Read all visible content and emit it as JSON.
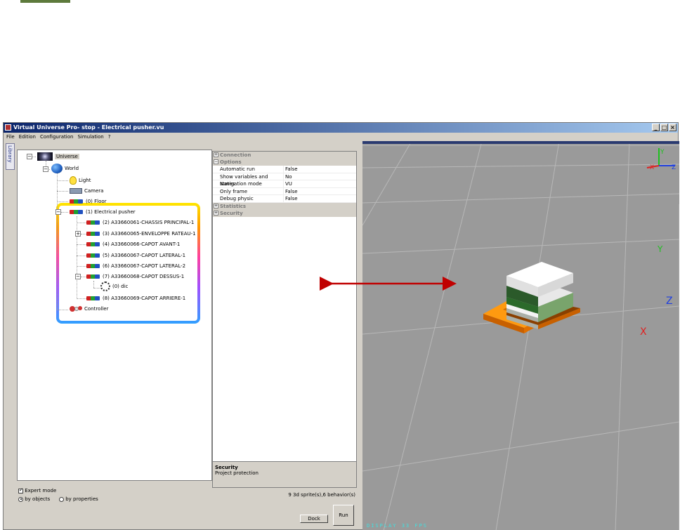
{
  "window": {
    "title": "Virtual Universe Pro- stop - Electrical pusher.vu",
    "buttons": [
      "_",
      "□",
      "×"
    ]
  },
  "menu": [
    "File",
    "Edition",
    "Configuration",
    "Simulation",
    "?"
  ],
  "library_tab": "Library",
  "tree": {
    "universe": "Universe",
    "world": "World",
    "light": "Light",
    "camera": "Camera",
    "floor": "(0) Floor",
    "pusher": "(1) Electrical pusher",
    "children": [
      "(2) A33660061-CHASSIS PRINCIPAL-1",
      "(3) A33660065-ENVELOPPE RATEAU-1",
      "(4) A33660066-CAPOT AVANT-1",
      "(5) A33660067-CAPOT LATERAL-1",
      "(6) A33660067-CAPOT LATERAL-2",
      "(7) A33660068-CAPOT DESSUS-1"
    ],
    "dic": "(0) dic",
    "last_child": "(8) A33660069-CAPOT ARRIERE-1",
    "controller": "Controller"
  },
  "properties": {
    "sections": {
      "connection": "Connection",
      "options": "Options",
      "statistics": "Statistics",
      "security": "Security"
    },
    "rows": [
      {
        "key": "Automatic run",
        "value": "False"
      },
      {
        "key": "Show variables and states",
        "value": "No"
      },
      {
        "key": "Navigation mode",
        "value": "VU"
      },
      {
        "key": "Only frame",
        "value": "False"
      },
      {
        "key": "Debug physic",
        "value": "False"
      }
    ],
    "description_title": "Security",
    "description_text": "Project protection"
  },
  "bottom": {
    "expert_mode": "Expert mode",
    "by_objects": "by objects",
    "by_properties": "by properties",
    "status": "9 3d sprite(s),6 behavior(s)",
    "dock": "Dock",
    "run": "Run"
  },
  "viewport": {
    "axis_labels": [
      "Y",
      "Z",
      "X"
    ],
    "gizmo_labels": [
      "Y",
      "Z",
      "X"
    ],
    "fps": "DISPLAY 33 FPS"
  },
  "colors": {
    "arrow": "#c00000",
    "titlebar": "#0a246a",
    "axis_x": "#e02020",
    "axis_y": "#20c020",
    "axis_z": "#2040e0"
  }
}
